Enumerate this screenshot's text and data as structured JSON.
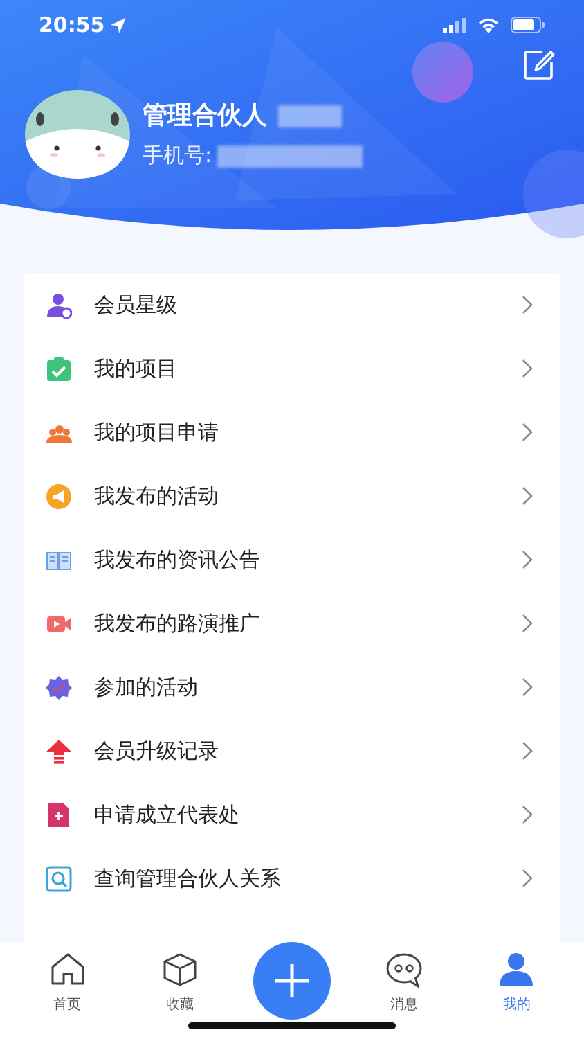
{
  "status_bar": {
    "time": "20:55"
  },
  "profile": {
    "name": "管理合伙人",
    "phone_label": "手机号:"
  },
  "menu": [
    {
      "label": "会员星级"
    },
    {
      "label": "我的项目"
    },
    {
      "label": "我的项目申请"
    },
    {
      "label": "我发布的活动"
    },
    {
      "label": "我发布的资讯公告"
    },
    {
      "label": "我发布的路演推广"
    },
    {
      "label": "参加的活动"
    },
    {
      "label": "会员升级记录"
    },
    {
      "label": "申请成立代表处"
    },
    {
      "label": "查询管理合伙人关系"
    }
  ],
  "tabs": [
    {
      "label": "首页",
      "selected": false
    },
    {
      "label": "收藏",
      "selected": false
    },
    {
      "kind": "add"
    },
    {
      "label": "消息",
      "selected": false
    },
    {
      "label": "我的",
      "selected": true
    }
  ]
}
